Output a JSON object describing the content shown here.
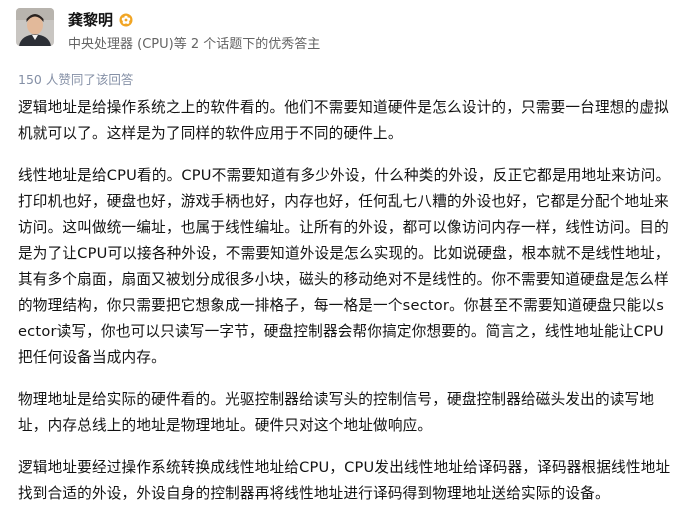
{
  "author": {
    "name": "龚黎明",
    "headline": "中央处理器 (CPU)等 2 个话题下的优秀答主",
    "badge_icon": "gold-flower-badge-icon"
  },
  "answer": {
    "voters_text": "150 人赞同了该回答",
    "paragraphs": [
      "逻辑地址是给操作系统之上的软件看的。他们不需要知道硬件是怎么设计的，只需要一台理想的虚拟机就可以了。这样是为了同样的软件应用于不同的硬件上。",
      "线性地址是给CPU看的。CPU不需要知道有多少外设，什么种类的外设，反正它都是用地址来访问。打印机也好，硬盘也好，游戏手柄也好，内存也好，任何乱七八糟的外设也好，它都是分配个地址来访问。这叫做统一编址，也属于线性编址。让所有的外设，都可以像访问内存一样，线性访问。目的是为了让CPU可以接各种外设，不需要知道外设是怎么实现的。比如说硬盘，根本就不是线性地址，其有多个扇面，扇面又被划分成很多小块，磁头的移动绝对不是线性的。你不需要知道硬盘是怎么样的物理结构，你只需要把它想象成一排格子，每一格是一个sector。你甚至不需要知道硬盘只能以sector读写，你也可以只读写一字节，硬盘控制器会帮你搞定你想要的。简言之，线性地址能让CPU把任何设备当成内存。",
      "物理地址是给实际的硬件看的。光驱控制器给读写头的控制信号，硬盘控制器给磁头发出的读写地址，内存总线上的地址是物理地址。硬件只对这个地址做响应。",
      "逻辑地址要经过操作系统转换成线性地址给CPU，CPU发出线性地址给译码器，译码器根据线性地址找到合适的外设，外设自身的控制器再将线性地址进行译码得到物理地址送给实际的设备。"
    ]
  }
}
